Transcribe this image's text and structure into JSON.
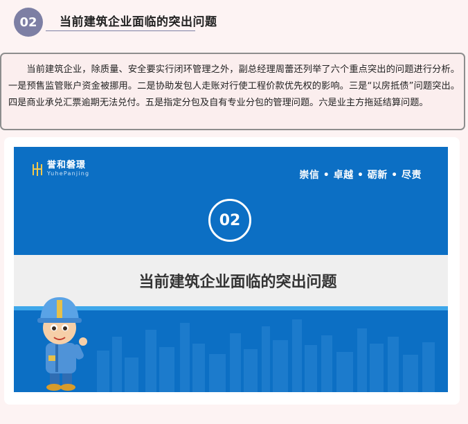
{
  "section": {
    "number": "02",
    "title": "当前建筑企业面临的突出问题"
  },
  "intro_paragraph": "当前建筑企业，除质量、安全要实行闭环管理之外，副总经理周蕾还列举了六个重点突出的问题进行分析。一是预售监管账户资金被挪用。二是协助发包人走账对行使工程价款优先权的影响。三是“以房抵债”问题突出。四是商业承兑汇票逾期无法兑付。五是指定分包及自有专业分包的管理问题。六是业主方拖延结算问题。",
  "banner": {
    "logo_cn": "誉和磐璟",
    "logo_en": "YuhePanjing",
    "slogan": "崇信 • 卓越 • 砺新 • 尽责",
    "number": "02",
    "title": "当前建筑企业面临的突出问题"
  },
  "colors": {
    "badge": "#7d7fa4",
    "banner_blue": "#0c6fc4",
    "accent_line": "#3ea7ea",
    "page_bg": "#fdf3f3"
  }
}
